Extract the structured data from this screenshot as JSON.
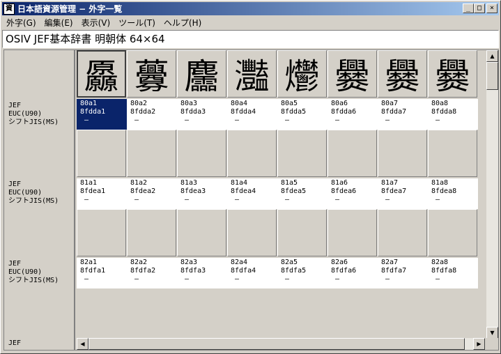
{
  "window": {
    "title": "日本語資源管理 − 外字一覧",
    "app_icon": "資",
    "minimize": "_",
    "maximize": "□",
    "close": "×"
  },
  "menu": [
    {
      "label": "外字(G)"
    },
    {
      "label": "編集(E)"
    },
    {
      "label": "表示(V)"
    },
    {
      "label": "ツール(T)"
    },
    {
      "label": "ヘルプ(H)"
    }
  ],
  "header": {
    "title": "OSIV JEF基本辞書 明朝体 64×64"
  },
  "row_labels": [
    {
      "jef": "JEF",
      "euc": "EUC(U90)",
      "sjis": "シフトJIS(MS)"
    },
    {
      "jef": "JEF",
      "euc": "EUC(U90)",
      "sjis": "シフトJIS(MS)"
    },
    {
      "jef": "JEF",
      "euc": "EUC(U90)",
      "sjis": "シフトJIS(MS)"
    },
    {
      "jef": "JEF"
    }
  ],
  "rows": [
    {
      "glyphs": [
        "厵",
        "虋",
        "麢",
        "灩",
        "爩",
        "爨",
        "爨",
        "爨"
      ],
      "cells": [
        {
          "jef": "80a1",
          "euc": "8fdda1",
          "sjis": "—",
          "selected": true
        },
        {
          "jef": "80a2",
          "euc": "8fdda2",
          "sjis": "—"
        },
        {
          "jef": "80a3",
          "euc": "8fdda3",
          "sjis": "—"
        },
        {
          "jef": "80a4",
          "euc": "8fdda4",
          "sjis": "—"
        },
        {
          "jef": "80a5",
          "euc": "8fdda5",
          "sjis": "—"
        },
        {
          "jef": "80a6",
          "euc": "8fdda6",
          "sjis": "—"
        },
        {
          "jef": "80a7",
          "euc": "8fdda7",
          "sjis": "—"
        },
        {
          "jef": "80a8",
          "euc": "8fdda8",
          "sjis": "—"
        }
      ]
    },
    {
      "glyphs": [
        "",
        "",
        "",
        "",
        "",
        "",
        "",
        ""
      ],
      "cells": [
        {
          "jef": "81a1",
          "euc": "8fdea1",
          "sjis": "—"
        },
        {
          "jef": "81a2",
          "euc": "8fdea2",
          "sjis": "—"
        },
        {
          "jef": "81a3",
          "euc": "8fdea3",
          "sjis": "—"
        },
        {
          "jef": "81a4",
          "euc": "8fdea4",
          "sjis": "—"
        },
        {
          "jef": "81a5",
          "euc": "8fdea5",
          "sjis": "—"
        },
        {
          "jef": "81a6",
          "euc": "8fdea6",
          "sjis": "—"
        },
        {
          "jef": "81a7",
          "euc": "8fdea7",
          "sjis": "—"
        },
        {
          "jef": "81a8",
          "euc": "8fdea8",
          "sjis": "—"
        }
      ]
    },
    {
      "glyphs": [
        "",
        "",
        "",
        "",
        "",
        "",
        "",
        ""
      ],
      "cells": [
        {
          "jef": "82a1",
          "euc": "8fdfa1",
          "sjis": "—"
        },
        {
          "jef": "82a2",
          "euc": "8fdfa2",
          "sjis": "—"
        },
        {
          "jef": "82a3",
          "euc": "8fdfa3",
          "sjis": "—"
        },
        {
          "jef": "82a4",
          "euc": "8fdfa4",
          "sjis": "—"
        },
        {
          "jef": "82a5",
          "euc": "8fdfa5",
          "sjis": "—"
        },
        {
          "jef": "82a6",
          "euc": "8fdfa6",
          "sjis": "—"
        },
        {
          "jef": "82a7",
          "euc": "8fdfa7",
          "sjis": "—"
        },
        {
          "jef": "82a8",
          "euc": "8fdfa8",
          "sjis": "—"
        }
      ]
    }
  ],
  "scroll": {
    "up": "▲",
    "down": "▼",
    "left": "◀",
    "right": "▶"
  }
}
